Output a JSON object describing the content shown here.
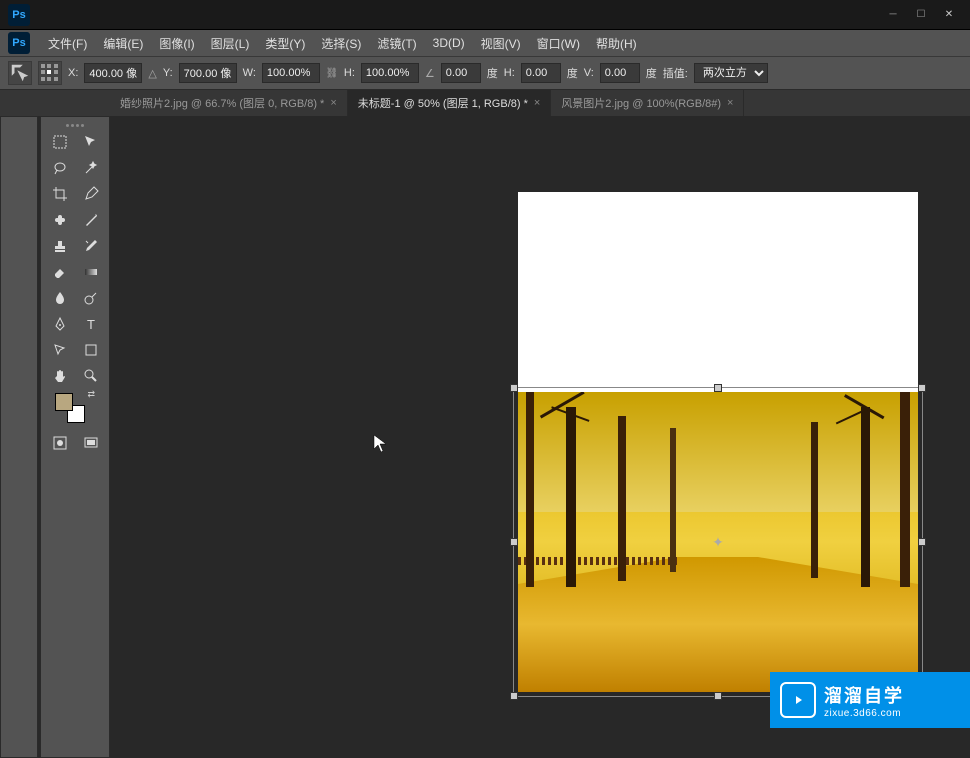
{
  "app": {
    "logo": "Ps"
  },
  "menu": {
    "file": "文件(F)",
    "edit": "编辑(E)",
    "image": "图像(I)",
    "layer": "图层(L)",
    "type": "类型(Y)",
    "select": "选择(S)",
    "filter": "滤镜(T)",
    "threeD": "3D(D)",
    "view": "视图(V)",
    "window": "窗口(W)",
    "help": "帮助(H)"
  },
  "options": {
    "x_label": "X:",
    "x_value": "400.00 像",
    "y_label": "Y:",
    "y_value": "700.00 像",
    "w_label": "W:",
    "w_value": "100.00%",
    "h_label": "H:",
    "h_value": "100.00%",
    "angle_value": "0.00",
    "angle_unit": "度",
    "h2_label": "H:",
    "h2_value": "0.00",
    "h2_unit": "度",
    "v_label": "V:",
    "v_value": "0.00",
    "v_unit": "度",
    "interp_label": "插值:",
    "interp_value": "两次立方"
  },
  "tabs": {
    "tab1": "婚纱照片2.jpg @ 66.7% (图层 0, RGB/8) *",
    "tab2": "未标题-1 @ 50% (图层 1, RGB/8) *",
    "tab3": "风景图片2.jpg @ 100%(RGB/8#)"
  },
  "swatches": {
    "fg": "#b8a780",
    "bg": "#ffffff"
  },
  "watermark": {
    "title": "溜溜自学",
    "url": "zixue.3d66.com"
  }
}
